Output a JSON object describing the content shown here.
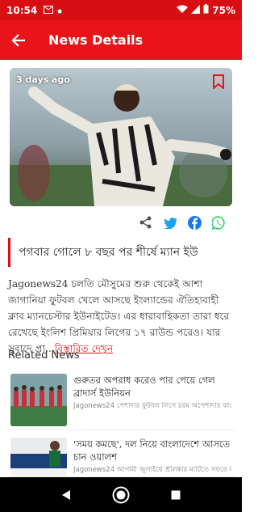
{
  "status_bar": {
    "time": "10:54",
    "battery": "75%"
  },
  "app_bar": {
    "title": "News Details",
    "back_icon": "arrow-back-icon"
  },
  "hero": {
    "age": "3 days ago",
    "bookmark_icon": "bookmark-icon"
  },
  "share_icons": [
    "share-icon",
    "twitter-icon",
    "facebook-icon",
    "whatsapp-icon"
  ],
  "article": {
    "headline": "পগবার গোলে ৮ বছর পর শীর্ষে ম্যান ইউ",
    "body": "Jagonews24 চলতি মৌসুমের শুরু থেকেই আশা জাগানিয়া ফুটবল খেলে আসছে ইংল্যান্ডের ঐতিহ্যবাহী ক্লাব ম্যানচেস্টার ইউনাইটেড। এর ধারাবাহিকতা তারা ধরে রেখেছে ইংলিশ প্রিমিয়ার লিগের ১৭ রাউন্ড পরেও। যার সুবাদে প্রা...",
    "more": "বিস্তারিত দেখুন"
  },
  "related": {
    "heading": "Related News",
    "items": [
      {
        "title": "গুরুতর অপরাধ করেও পার পেয়ে গেল ব্রাদার্স ইউনিয়ন",
        "desc": "Jagonews24 পেশাদার ফুটবল লিগে চরম অপেশাদার কাও করলো বাংলাদেশ ফুটবল ফেডারেশন (বাফুফে)। নিয়মনীতির তোয়াক্কা না করে নির্ধারিত সময়ের দুইদিন পর দলবদলে অংশ..."
      },
      {
        "title": "'সময় কমছে', দল নিয়ে বাংলাদেশে আসতে চান ওয়ালশ",
        "desc": "Jagonews24 আগামী জুলাইয়ে শ্রীলঙ্কার মাটিতে সফরে যাবে বাংলাদেশ..."
      }
    ]
  },
  "colors": {
    "accent": "#e8141a",
    "status": "#d80f12"
  }
}
